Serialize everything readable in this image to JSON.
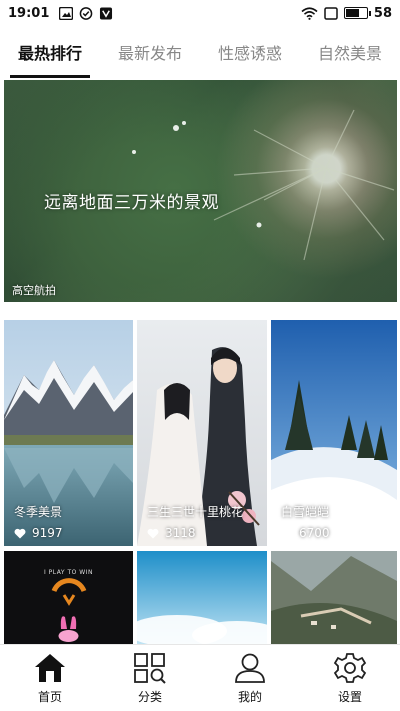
{
  "status": {
    "time": "19:01",
    "battery": "58",
    "battery_level": 0.58
  },
  "tabs": [
    {
      "label": "最热排行",
      "active": true
    },
    {
      "label": "最新发布",
      "active": false
    },
    {
      "label": "性感诱惑",
      "active": false
    },
    {
      "label": "自然美景",
      "active": false
    }
  ],
  "banner": {
    "caption": "远离地面三万米的景观",
    "tag": "高空航拍"
  },
  "cards": [
    {
      "title": "冬季美景",
      "likes": "9197"
    },
    {
      "title": "三生三世十里桃花",
      "likes": "3118"
    },
    {
      "title": "白雪皑皑",
      "likes": "6700"
    },
    {
      "promo": "I PLAY TO WIN"
    }
  ],
  "nav": [
    {
      "label": "首页",
      "icon": "home-icon"
    },
    {
      "label": "分类",
      "icon": "grid-search-icon"
    },
    {
      "label": "我的",
      "icon": "user-icon"
    },
    {
      "label": "设置",
      "icon": "gear-icon"
    }
  ]
}
